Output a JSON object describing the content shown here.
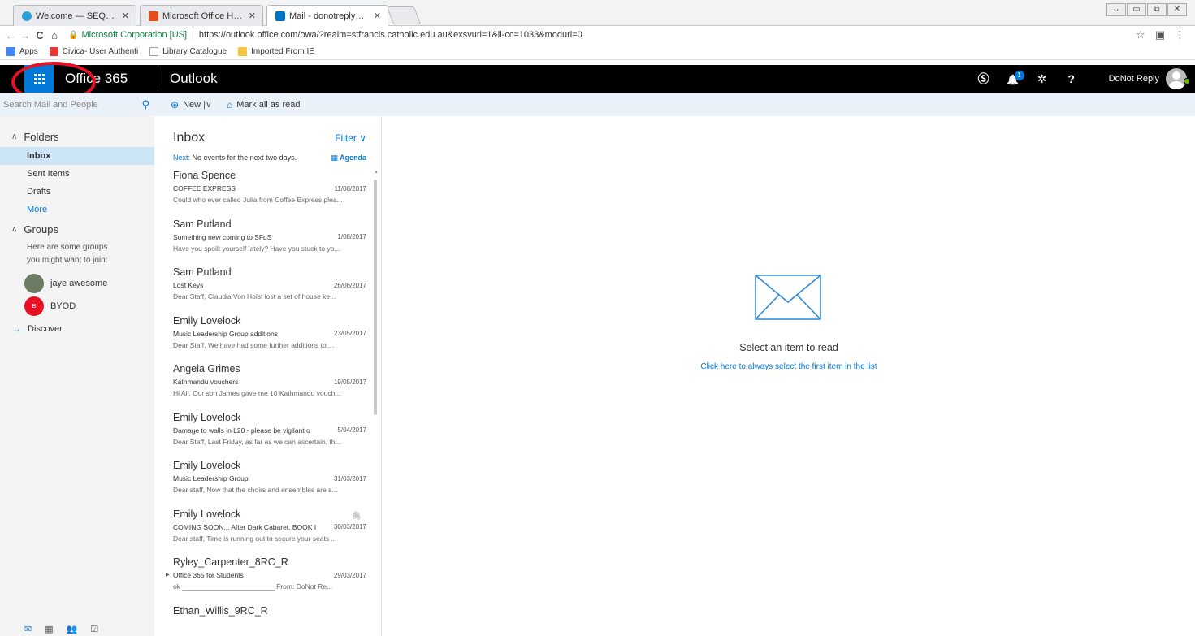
{
  "browser": {
    "tabs": [
      {
        "label": "Welcome — SEQTA Teac",
        "close": "✕",
        "color": "#2f9fd8"
      },
      {
        "label": "Microsoft Office Home",
        "close": "✕",
        "color": "#e74c1c"
      },
      {
        "label": "Mail - donotreply@stfran",
        "close": "✕",
        "color": "#0072c6"
      }
    ],
    "window_controls": [
      "ᴗ",
      "▭",
      "⧉",
      "✕"
    ],
    "nav": {
      "back": "←",
      "forward": "→",
      "reload": "C",
      "home": "⌂"
    },
    "secure_label": "Microsoft Corporation [US]",
    "url": "https://outlook.office.com/owa/?realm=stfrancis.catholic.edu.au&exsvurl=1&ll-cc=1033&modurl=0",
    "toolbar_icons": [
      "☆",
      "▣",
      "⋮"
    ],
    "bookmarks": [
      {
        "label": "Apps",
        "color": "#4285f4"
      },
      {
        "label": "Civica- User Authenti",
        "color": "#e53935"
      },
      {
        "label": "Library Catalogue",
        "color": "#9e9e9e"
      },
      {
        "label": "Imported From IE",
        "color": "#f4c542"
      }
    ]
  },
  "header": {
    "brand": "Office 365",
    "app": "Outlook",
    "icons": [
      "skype-icon",
      "bell-icon",
      "gear-icon",
      "help-icon"
    ],
    "skype_glyph": "Ⓢ",
    "bell_glyph": "🔔",
    "gear_glyph": "✲",
    "help_glyph": "?",
    "notification_count": "1",
    "user": "DoNot Reply"
  },
  "command_bar": {
    "search_placeholder": "Search Mail and People",
    "new_label": "New",
    "new_glyph": "⊕",
    "split_glyph": "|∨",
    "mark_all_label": "Mark all as read",
    "mark_glyph": "⌂"
  },
  "left_nav": {
    "folders_label": "Folders",
    "chevron": "∧",
    "folders": [
      "Inbox",
      "Sent Items",
      "Drafts"
    ],
    "more_label": "More",
    "groups_label": "Groups",
    "groups_note_1": "Here are some groups",
    "groups_note_2": "you might want to join:",
    "groups": [
      {
        "name": "jaye awesome",
        "initial": "",
        "color": "#6b7c63"
      },
      {
        "name": "BYOD",
        "initial": "B",
        "color": "#e81123"
      }
    ],
    "discover_label": "Discover",
    "discover_arrow": "→",
    "bottom_icons": [
      "✉",
      "▦",
      "👥",
      "☑"
    ]
  },
  "message_list": {
    "title": "Inbox",
    "filter_label": "Filter ∨",
    "next_label": "Next:",
    "next_text": "No events for the next two days.",
    "agenda_label": "Agenda",
    "messages": [
      {
        "sender": "Fiona Spence",
        "subject": "COFFEE EXPRESS",
        "date": "11/08/2017",
        "preview": "Could who ever called Julia from Coffee Express plea..."
      },
      {
        "sender": "Sam Putland",
        "subject": "Something new coming to SFdS",
        "date": "1/08/2017",
        "preview": "Have you spoilt yourself lately? Have you stuck to yo..."
      },
      {
        "sender": "Sam Putland",
        "subject": "Lost Keys",
        "date": "26/06/2017",
        "preview": "Dear Staff,  Claudia Von Holst lost a set of house ke..."
      },
      {
        "sender": "Emily Lovelock",
        "subject": "Music Leadership Group additions",
        "date": "23/05/2017",
        "preview": "Dear Staff,  We have had some further additions to ..."
      },
      {
        "sender": "Angela Grimes",
        "subject": "Kathmandu vouchers",
        "date": "19/05/2017",
        "preview": "Hi All,  Our son James gave me 10 Kathmandu vouch..."
      },
      {
        "sender": "Emily Lovelock",
        "subject": "Damage to walls in L20 - please be vigilant o",
        "date": "5/04/2017",
        "preview": "Dear Staff,  Last Friday, as far as we can ascertain, th..."
      },
      {
        "sender": "Emily Lovelock",
        "subject": "Music Leadership Group",
        "date": "31/03/2017",
        "preview": "Dear staff,  Now that the choirs and ensembles are s..."
      },
      {
        "sender": "Emily Lovelock",
        "subject": "COMING SOON... After Dark Cabaret. BOOK I",
        "date": "30/03/2017",
        "preview": "Dear staff,  Time is running out to secure your seats ...",
        "attachment": "🖇"
      },
      {
        "sender": "Ryley_Carpenter_8RC_R",
        "subject": "Office 365 for Students",
        "date": "29/03/2017",
        "preview": "ok  ________________________ From: DoNot Re...",
        "expand": "▶"
      },
      {
        "sender": "Ethan_Willis_9RC_R",
        "subject": "",
        "date": "",
        "preview": ""
      }
    ]
  },
  "reading_pane": {
    "empty_title": "Select an item to read",
    "link": "Click here to always select the first item in the list"
  },
  "colors": {
    "accent": "#0078d7",
    "header": "#000000",
    "annotation": "#e81123"
  }
}
